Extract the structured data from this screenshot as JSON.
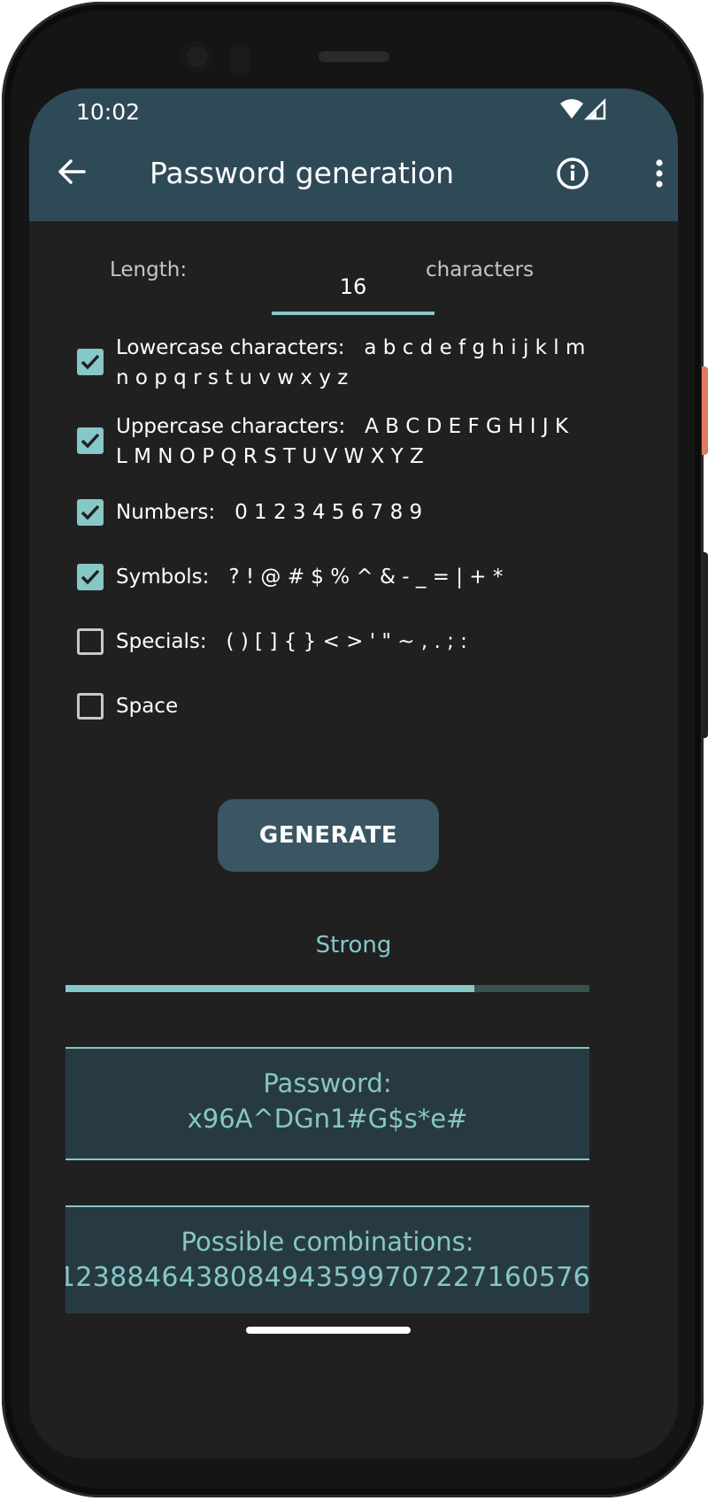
{
  "status_bar": {
    "time": "10:02",
    "icons": [
      "wifi-icon",
      "cell-signal-icon"
    ]
  },
  "app_bar": {
    "title": "Password generation",
    "icons": [
      "back-arrow-icon",
      "info-icon",
      "more-vert-icon"
    ]
  },
  "length": {
    "label": "Length:",
    "value": "16",
    "suffix": "characters"
  },
  "options": [
    {
      "label": "Lowercase characters:",
      "chars_line1": "a b c d e f g h i j k l m",
      "chars_line2": "n o p q r s t u v w x y z",
      "checked": true
    },
    {
      "label": "Uppercase characters:",
      "chars_line1": "A B C D E F G H I J K",
      "chars_line2": "L M N O P Q R S T U V W X Y Z",
      "checked": true
    },
    {
      "label": "Numbers:",
      "chars_line1": "0 1 2 3 4 5 6 7 8 9",
      "checked": true
    },
    {
      "label": "Symbols:",
      "chars_line1": "? ! @ # $ % ^ & - _ = | + *",
      "checked": true
    },
    {
      "label": "Specials:",
      "chars_line1": "( ) [ ] { } < > ' \" ~ , . ; :",
      "checked": false
    },
    {
      "label": "Space",
      "chars_line1": "",
      "checked": false
    }
  ],
  "generate_button": "GENERATE",
  "strength": {
    "label": "Strong",
    "level": 0.78
  },
  "password": {
    "label": "Password:",
    "value": "x96A^DGn1#G$s*e#"
  },
  "combinations": {
    "label": "Possible combinations:",
    "value": "1238846438084943599707227160576"
  },
  "colors": {
    "app_bar": "#2f4a57",
    "accent": "#86c7c7",
    "background": "#202020",
    "button": "#3a5563"
  }
}
